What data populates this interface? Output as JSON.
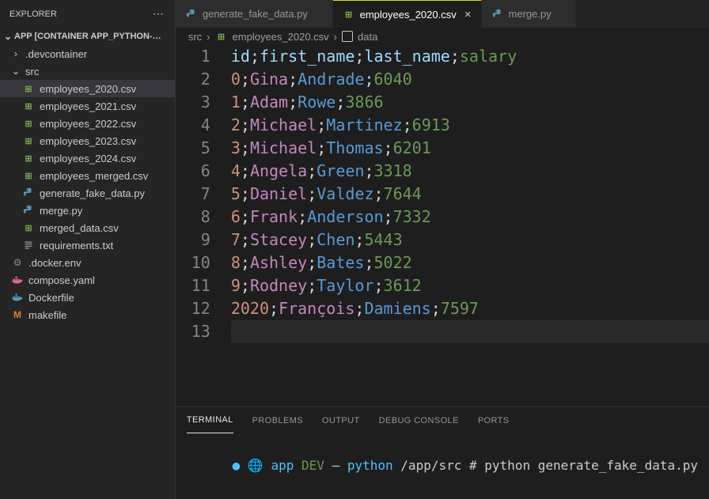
{
  "sidebar": {
    "title": "EXPLORER",
    "section_title": "APP [CONTAINER APP_PYTHON-…",
    "items": [
      {
        "type": "folder",
        "name": ".devcontainer",
        "depth": 0,
        "collapsed": true,
        "icon": "folder"
      },
      {
        "type": "folder",
        "name": "src",
        "depth": 0,
        "collapsed": false,
        "icon": "folder"
      },
      {
        "type": "file",
        "name": "employees_2020.csv",
        "depth": 1,
        "icon": "csv",
        "selected": true
      },
      {
        "type": "file",
        "name": "employees_2021.csv",
        "depth": 1,
        "icon": "csv"
      },
      {
        "type": "file",
        "name": "employees_2022.csv",
        "depth": 1,
        "icon": "csv"
      },
      {
        "type": "file",
        "name": "employees_2023.csv",
        "depth": 1,
        "icon": "csv"
      },
      {
        "type": "file",
        "name": "employees_2024.csv",
        "depth": 1,
        "icon": "csv"
      },
      {
        "type": "file",
        "name": "employees_merged.csv",
        "depth": 1,
        "icon": "csv"
      },
      {
        "type": "file",
        "name": "generate_fake_data.py",
        "depth": 1,
        "icon": "python"
      },
      {
        "type": "file",
        "name": "merge.py",
        "depth": 1,
        "icon": "python"
      },
      {
        "type": "file",
        "name": "merged_data.csv",
        "depth": 1,
        "icon": "csv"
      },
      {
        "type": "file",
        "name": "requirements.txt",
        "depth": 1,
        "icon": "txt"
      },
      {
        "type": "file",
        "name": ".docker.env",
        "depth": 0,
        "icon": "gear"
      },
      {
        "type": "file",
        "name": "compose.yaml",
        "depth": 0,
        "icon": "docker-compose"
      },
      {
        "type": "file",
        "name": "Dockerfile",
        "depth": 0,
        "icon": "dockerfile"
      },
      {
        "type": "file",
        "name": "makefile",
        "depth": 0,
        "icon": "makefile"
      }
    ]
  },
  "tabs": [
    {
      "label": "generate_fake_data.py",
      "icon": "python",
      "active": false
    },
    {
      "label": "employees_2020.csv",
      "icon": "csv",
      "active": true
    },
    {
      "label": "merge.py",
      "icon": "python",
      "active": false
    }
  ],
  "breadcrumbs": {
    "path": [
      "src"
    ],
    "file": "employees_2020.csv",
    "symbol": "data"
  },
  "editor": {
    "lines": [
      {
        "n": 1,
        "segments": [
          [
            "id",
            "field"
          ],
          [
            ";",
            "punc"
          ],
          [
            "first_name",
            "field"
          ],
          [
            ";",
            "punc"
          ],
          [
            "last_name",
            "field"
          ],
          [
            ";",
            "punc"
          ],
          [
            "salary",
            "gray"
          ]
        ]
      },
      {
        "n": 2,
        "segments": [
          [
            "0",
            "num"
          ],
          [
            ";",
            "punc"
          ],
          [
            "Gina",
            "name"
          ],
          [
            ";",
            "punc"
          ],
          [
            "Andrade",
            "other"
          ],
          [
            ";",
            "punc"
          ],
          [
            "6040",
            "gray"
          ]
        ]
      },
      {
        "n": 3,
        "segments": [
          [
            "1",
            "num"
          ],
          [
            ";",
            "punc"
          ],
          [
            "Adam",
            "name"
          ],
          [
            ";",
            "punc"
          ],
          [
            "Rowe",
            "other"
          ],
          [
            ";",
            "punc"
          ],
          [
            "3866",
            "gray"
          ]
        ]
      },
      {
        "n": 4,
        "segments": [
          [
            "2",
            "num"
          ],
          [
            ";",
            "punc"
          ],
          [
            "Michael",
            "name"
          ],
          [
            ";",
            "punc"
          ],
          [
            "Martinez",
            "other"
          ],
          [
            ";",
            "punc"
          ],
          [
            "6913",
            "gray"
          ]
        ]
      },
      {
        "n": 5,
        "segments": [
          [
            "3",
            "num"
          ],
          [
            ";",
            "punc"
          ],
          [
            "Michael",
            "name"
          ],
          [
            ";",
            "punc"
          ],
          [
            "Thomas",
            "other"
          ],
          [
            ";",
            "punc"
          ],
          [
            "6201",
            "gray"
          ]
        ]
      },
      {
        "n": 6,
        "segments": [
          [
            "4",
            "num"
          ],
          [
            ";",
            "punc"
          ],
          [
            "Angela",
            "name"
          ],
          [
            ";",
            "punc"
          ],
          [
            "Green",
            "other"
          ],
          [
            ";",
            "punc"
          ],
          [
            "3318",
            "gray"
          ]
        ]
      },
      {
        "n": 7,
        "segments": [
          [
            "5",
            "num"
          ],
          [
            ";",
            "punc"
          ],
          [
            "Daniel",
            "name"
          ],
          [
            ";",
            "punc"
          ],
          [
            "Valdez",
            "other"
          ],
          [
            ";",
            "punc"
          ],
          [
            "7644",
            "gray"
          ]
        ]
      },
      {
        "n": 8,
        "segments": [
          [
            "6",
            "num"
          ],
          [
            ";",
            "punc"
          ],
          [
            "Frank",
            "name"
          ],
          [
            ";",
            "punc"
          ],
          [
            "Anderson",
            "other"
          ],
          [
            ";",
            "punc"
          ],
          [
            "7332",
            "gray"
          ]
        ]
      },
      {
        "n": 9,
        "segments": [
          [
            "7",
            "num"
          ],
          [
            ";",
            "punc"
          ],
          [
            "Stacey",
            "name"
          ],
          [
            ";",
            "punc"
          ],
          [
            "Chen",
            "other"
          ],
          [
            ";",
            "punc"
          ],
          [
            "5443",
            "gray"
          ]
        ]
      },
      {
        "n": 10,
        "segments": [
          [
            "8",
            "num"
          ],
          [
            ";",
            "punc"
          ],
          [
            "Ashley",
            "name"
          ],
          [
            ";",
            "punc"
          ],
          [
            "Bates",
            "other"
          ],
          [
            ";",
            "punc"
          ],
          [
            "5022",
            "gray"
          ]
        ]
      },
      {
        "n": 11,
        "segments": [
          [
            "9",
            "num"
          ],
          [
            ";",
            "punc"
          ],
          [
            "Rodney",
            "name"
          ],
          [
            ";",
            "punc"
          ],
          [
            "Taylor",
            "other"
          ],
          [
            ";",
            "punc"
          ],
          [
            "3612",
            "gray"
          ]
        ]
      },
      {
        "n": 12,
        "segments": [
          [
            "2020",
            "num"
          ],
          [
            ";",
            "punc"
          ],
          [
            "François",
            "name"
          ],
          [
            ";",
            "punc"
          ],
          [
            "Damiens",
            "other"
          ],
          [
            ";",
            "punc"
          ],
          [
            "7597",
            "gray"
          ]
        ]
      },
      {
        "n": 13,
        "segments": [],
        "cursor": true
      }
    ]
  },
  "panel": {
    "tabs": [
      "TERMINAL",
      "PROBLEMS",
      "OUTPUT",
      "DEBUG CONSOLE",
      "PORTS"
    ],
    "active_tab": "TERMINAL",
    "terminal": {
      "app": "app",
      "env": "DEV",
      "sep": "–",
      "shell": "python",
      "path": "/app/src",
      "prompt_suffix": "#",
      "command": "python generate_fake_data.py"
    }
  }
}
